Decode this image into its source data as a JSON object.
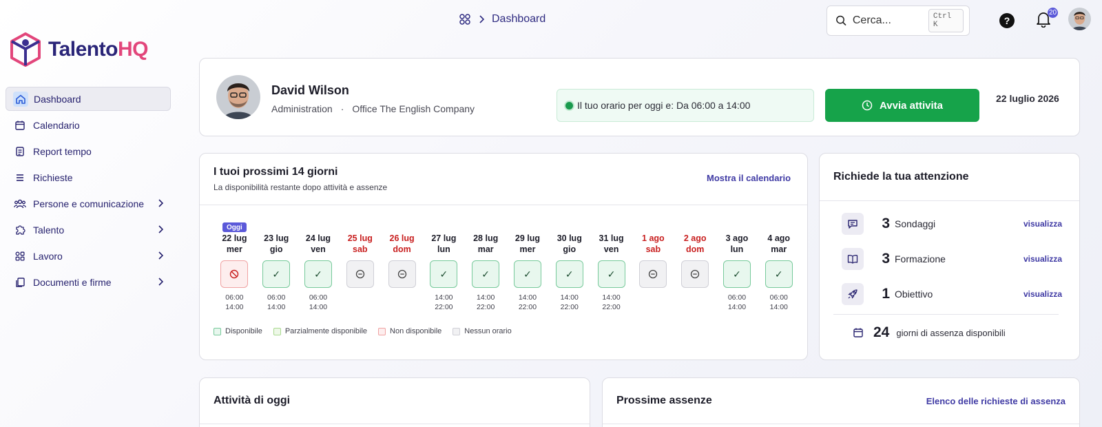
{
  "brand": {
    "name_main": "Talento",
    "name_accent": "HQ",
    "logo_color": "#e2467b",
    "text_color": "#2a2578"
  },
  "sidebar": {
    "items": [
      {
        "label": "Dashboard",
        "icon": "home-icon",
        "active": true
      },
      {
        "label": "Calendario",
        "icon": "calendar-icon"
      },
      {
        "label": "Report tempo",
        "icon": "report-icon"
      },
      {
        "label": "Richieste",
        "icon": "list-icon"
      },
      {
        "label": "Persone e comunicazione",
        "icon": "people-icon",
        "has_children": true
      },
      {
        "label": "Talento",
        "icon": "puzzle-icon",
        "has_children": true
      },
      {
        "label": "Lavoro",
        "icon": "grid-icon",
        "has_children": true
      },
      {
        "label": "Documenti e firme",
        "icon": "documents-icon",
        "has_children": true
      }
    ]
  },
  "topbar": {
    "breadcrumb": "Dashboard",
    "search_placeholder": "Cerca...",
    "search_shortcut": "Ctrl K",
    "notifications_count": "20"
  },
  "profile": {
    "name": "David Wilson",
    "department": "Administration",
    "separator": "·",
    "office": "Office The English Company",
    "schedule_text": "Il tuo orario per oggi e: Da 06:00 a 14:00",
    "start_button": "Avvia attivita",
    "date": "22 luglio 2026"
  },
  "days_panel": {
    "title": "I tuoi prossimi 14 giorni",
    "subtitle": "La disponibilità restante dopo attività e assenze",
    "link": "Mostra il calendario",
    "today_badge": "Oggi",
    "days": [
      {
        "date": "22 lug",
        "weekday": "mer",
        "status": "unavailable",
        "start": "06:00",
        "end": "14:00",
        "today": true
      },
      {
        "date": "23 lug",
        "weekday": "gio",
        "status": "available",
        "start": "06:00",
        "end": "14:00"
      },
      {
        "date": "24 lug",
        "weekday": "ven",
        "status": "available",
        "start": "06:00",
        "end": "14:00"
      },
      {
        "date": "25 lug",
        "weekday": "sab",
        "status": "none",
        "weekend": true
      },
      {
        "date": "26 lug",
        "weekday": "dom",
        "status": "none",
        "weekend": true
      },
      {
        "date": "27 lug",
        "weekday": "lun",
        "status": "available",
        "start": "14:00",
        "end": "22:00"
      },
      {
        "date": "28 lug",
        "weekday": "mar",
        "status": "available",
        "start": "14:00",
        "end": "22:00"
      },
      {
        "date": "29 lug",
        "weekday": "mer",
        "status": "available",
        "start": "14:00",
        "end": "22:00"
      },
      {
        "date": "30 lug",
        "weekday": "gio",
        "status": "available",
        "start": "14:00",
        "end": "22:00"
      },
      {
        "date": "31 lug",
        "weekday": "ven",
        "status": "available",
        "start": "14:00",
        "end": "22:00"
      },
      {
        "date": "1 ago",
        "weekday": "sab",
        "status": "none",
        "weekend": true
      },
      {
        "date": "2 ago",
        "weekday": "dom",
        "status": "none",
        "weekend": true
      },
      {
        "date": "3 ago",
        "weekday": "lun",
        "status": "available",
        "start": "06:00",
        "end": "14:00"
      },
      {
        "date": "4 ago",
        "weekday": "mar",
        "status": "available",
        "start": "06:00",
        "end": "14:00"
      }
    ],
    "legend": [
      {
        "label": "Disponibile",
        "color": "#e8f7ee",
        "border": "#76c99a"
      },
      {
        "label": "Parzialmente disponibile",
        "color": "#eef8e8",
        "border": "#a9d98f"
      },
      {
        "label": "Non disponibile",
        "color": "#fdeeee",
        "border": "#f0a2a2"
      },
      {
        "label": "Nessun orario",
        "color": "#f1f1f3",
        "border": "#cfcfd6"
      }
    ]
  },
  "attention": {
    "title": "Richiede la tua attenzione",
    "items": [
      {
        "count": "3",
        "label": "Sondaggi",
        "link": "visualizza",
        "icon": "chat-icon"
      },
      {
        "count": "3",
        "label": "Formazione",
        "link": "visualizza",
        "icon": "book-icon"
      },
      {
        "count": "1",
        "label": "Obiettivo",
        "link": "visualizza",
        "icon": "rocket-icon"
      }
    ],
    "absence_count": "24",
    "absence_label": "giorni di assenza disponibili"
  },
  "today_activities": {
    "title": "Attività di oggi"
  },
  "upcoming_absences": {
    "title": "Prossime assenze",
    "link": "Elenco delle richieste di assenza"
  },
  "colors": {
    "accent": "#5b59d9",
    "primary_button": "#16a34a",
    "link": "#3f3aa4",
    "weekend": "#c81e1e"
  }
}
